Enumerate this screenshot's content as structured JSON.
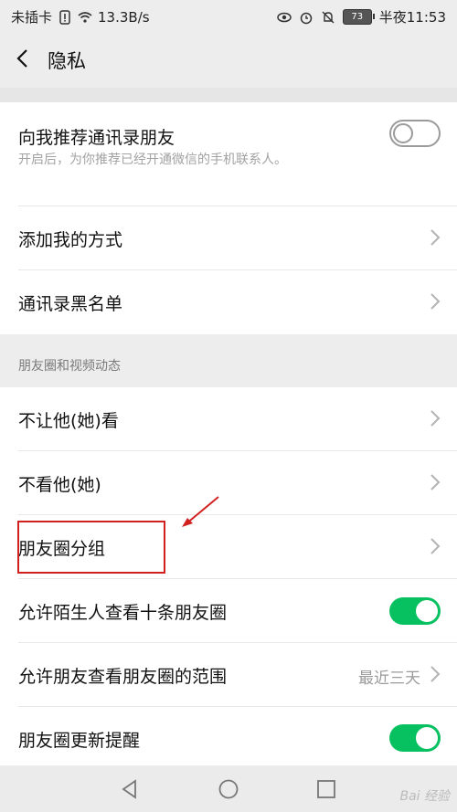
{
  "status_bar": {
    "carrier": "未插卡",
    "net_speed": "13.3B/s",
    "battery": "73",
    "time": "半夜11:53"
  },
  "header": {
    "title": "隐私"
  },
  "rows": {
    "recommend_contacts": {
      "label": "向我推荐通讯录朋友",
      "desc": "开启后，为你推荐已经开通微信的手机联系人。",
      "toggle": "off"
    },
    "add_me_methods": {
      "label": "添加我的方式"
    },
    "contacts_blacklist": {
      "label": "通讯录黑名单"
    }
  },
  "moments_section": {
    "header": "朋友圈和视频动态",
    "items": [
      {
        "label": "不让他(她)看"
      },
      {
        "label": "不看他(她)"
      },
      {
        "label": "朋友圈分组"
      },
      {
        "label": "允许陌生人查看十条朋友圈",
        "toggle": "on"
      },
      {
        "label": "允许朋友查看朋友圈的范围",
        "value": "最近三天"
      },
      {
        "label": "朋友圈更新提醒",
        "toggle": "on"
      }
    ]
  },
  "colors": {
    "toggle_on": "#07c160",
    "highlight": "#d12020"
  },
  "watermark": "Bai 经验"
}
